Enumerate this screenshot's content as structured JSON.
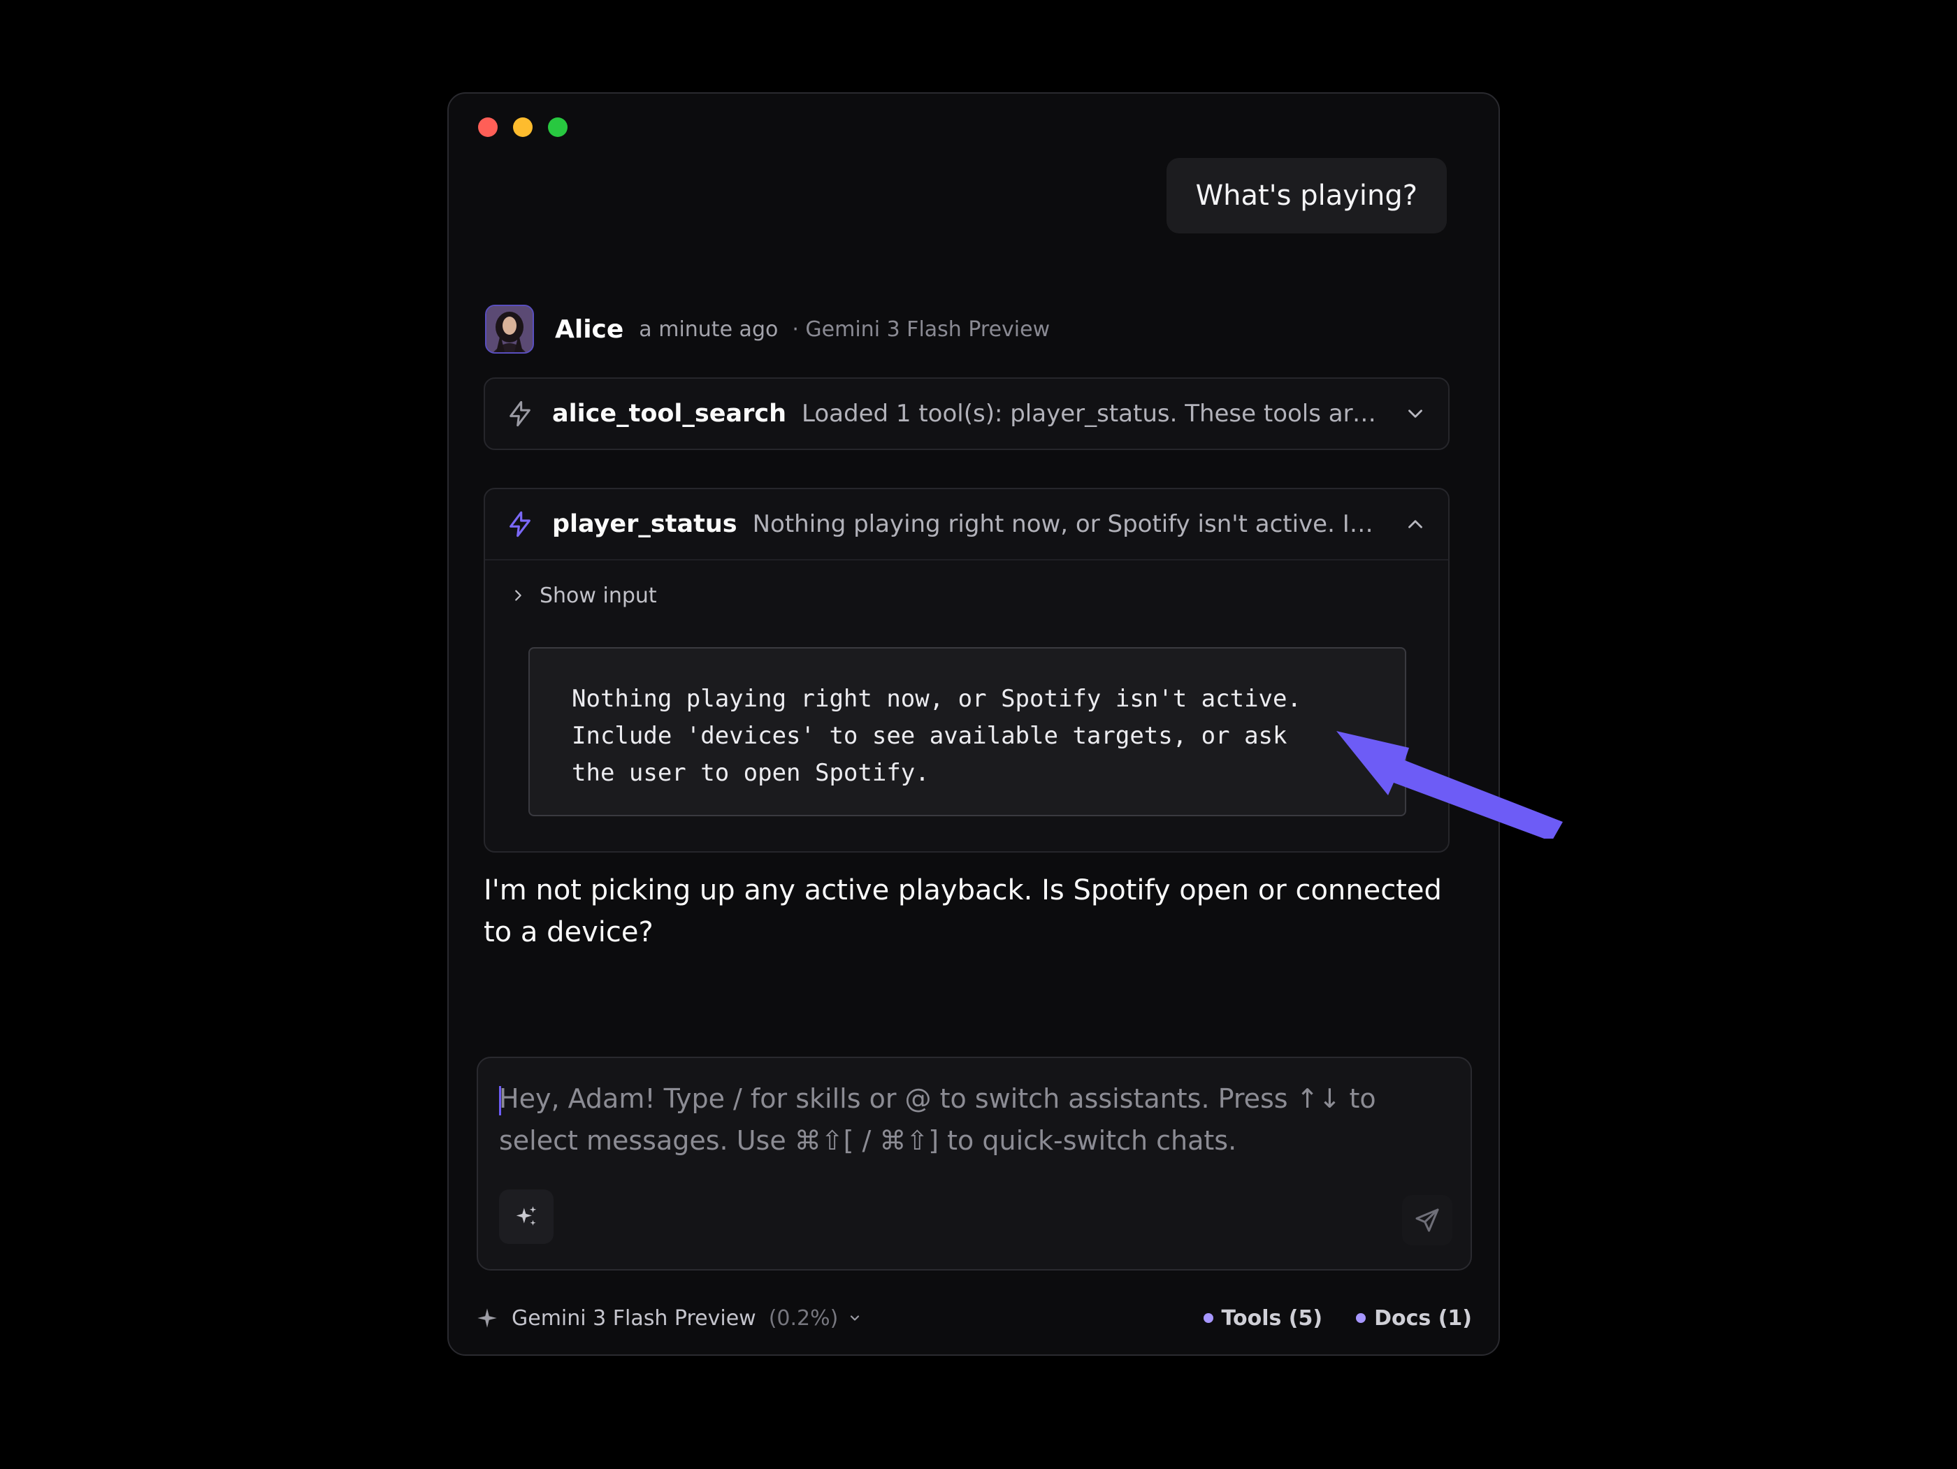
{
  "conversation": {
    "user_message": "What's playing?",
    "assistant": {
      "name": "Alice",
      "time": "a minute ago",
      "model": "· Gemini 3 Flash Preview"
    },
    "tool_calls": [
      {
        "name": "alice_tool_search",
        "summary": "Loaded 1 tool(s): player_status. These tools are no...",
        "expanded": false
      },
      {
        "name": "player_status",
        "summary": "Nothing playing right now, or Spotify isn't active. Inclu...",
        "expanded": true,
        "show_input_label": "Show input",
        "output": "Nothing playing right now, or Spotify isn't active.\nInclude 'devices' to see available targets, or ask\nthe user to open Spotify."
      }
    ],
    "reply": "I'm not picking up any active playback. Is Spotify open or connected to a device?"
  },
  "composer": {
    "placeholder": "Hey, Adam! Type / for skills or @ to switch assistants. Press ↑↓ to select messages. Use ⌘⇧[ / ⌘⇧] to quick-switch chats.",
    "value": ""
  },
  "footer": {
    "model": "Gemini 3 Flash Preview",
    "usage": "(0.2%)",
    "tools": "Tools (5)",
    "docs": "Docs (1)"
  },
  "icons": {
    "tool_icon_1": "lightning-bolt-icon",
    "tool_icon_2": "lightning-bolt-icon",
    "composer_left": "sparkles-icon",
    "composer_right": "send-icon",
    "footer_model": "star-icon"
  },
  "colors": {
    "accent": "#6d5cf6",
    "background": "#0c0c0e",
    "annotation_arrow": "#6d5cf6"
  }
}
